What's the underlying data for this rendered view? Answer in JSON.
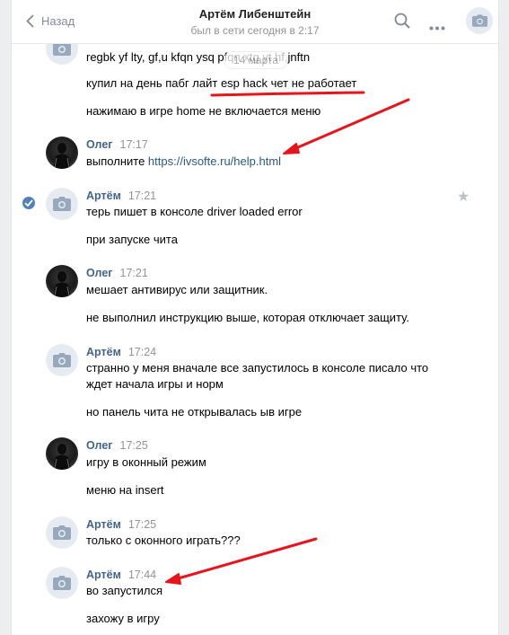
{
  "header": {
    "back_label": "Назад",
    "title": "Артём Либенштейн",
    "subtitle": "был в сети сегодня в 2:17"
  },
  "date_pill": "14 марта",
  "messages": [
    {
      "author": null,
      "time": null,
      "avatar": "camera",
      "lines": [
        "regbk yf lty, gf,u kfqn ysq  pfqn xtg yt hf,jnftn"
      ]
    },
    {
      "author": null,
      "time": null,
      "avatar": null,
      "lines": [
        "купил на день пабг лайт esp hack чет не работает"
      ]
    },
    {
      "author": null,
      "time": null,
      "avatar": null,
      "lines": [
        "нажимаю в игре home не включается меню"
      ]
    },
    {
      "author": "Олег",
      "time": "17:17",
      "avatar": "photo",
      "prefix": "выполните ",
      "link": "https://ivsofte.ru/help.html"
    },
    {
      "author": "Артём",
      "time": "17:21",
      "avatar": "camera",
      "lines": [
        "терь пишет в консоле driver loaded error"
      ]
    },
    {
      "author": null,
      "time": null,
      "avatar": null,
      "lines": [
        "при запуске чита"
      ]
    },
    {
      "author": "Олег",
      "time": "17:21",
      "avatar": "photo",
      "lines": [
        "мешает антивирус или защитник."
      ]
    },
    {
      "author": null,
      "time": null,
      "avatar": null,
      "lines": [
        "не выполнил инструкцию выше, которая отключает защиту."
      ]
    },
    {
      "author": "Артём",
      "time": "17:24",
      "avatar": "camera",
      "lines": [
        "странно у меня вначале все запустилось в консоле писало что",
        "ждет начала игры и норм"
      ]
    },
    {
      "author": null,
      "time": null,
      "avatar": null,
      "lines": [
        "но панель чита не открывалась ыв игре"
      ]
    },
    {
      "author": "Олег",
      "time": "17:25",
      "avatar": "photo",
      "lines": [
        "игру в оконный режим"
      ]
    },
    {
      "author": null,
      "time": null,
      "avatar": null,
      "lines": [
        "меню на insert"
      ]
    },
    {
      "author": "Артём",
      "time": "17:25",
      "avatar": "camera",
      "lines": [
        "только с оконного играть???"
      ]
    },
    {
      "author": "Артём",
      "time": "17:44",
      "avatar": "camera",
      "lines": [
        "во запустился"
      ]
    },
    {
      "author": null,
      "time": null,
      "avatar": null,
      "lines": [
        "захожу в игру"
      ]
    }
  ],
  "colors": {
    "annotation": "#e8141c",
    "link": "#2a5885",
    "author": "#42648b"
  },
  "icons": [
    "chevron-left-icon",
    "search-icon",
    "more-icon",
    "camera-icon",
    "check-icon",
    "star-icon"
  ]
}
